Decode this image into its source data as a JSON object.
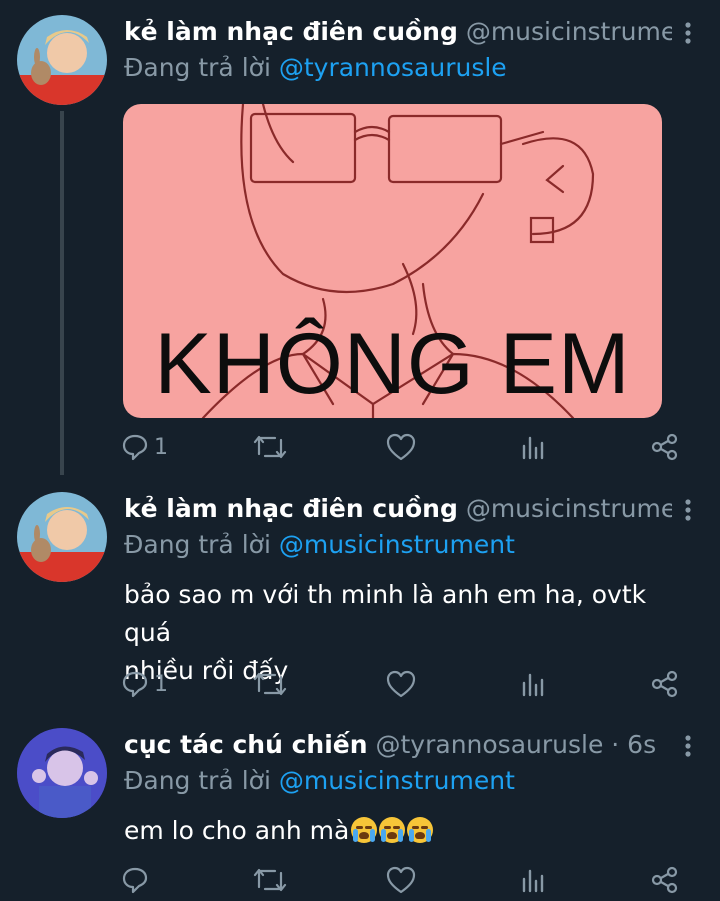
{
  "tweets": [
    {
      "name": "kẻ làm nhạc điên cuồng",
      "handle": "@musicinstrument ...",
      "replying_label": "Đang trả lời",
      "replying_to": "@tyrannosaurusle",
      "media_text": "KHÔNG EM",
      "replies": "1",
      "retweets": "",
      "likes": ""
    },
    {
      "name": "kẻ làm nhạc điên cuồng",
      "handle": "@musicinstrument ...",
      "replying_label": "Đang trả lời",
      "replying_to": "@musicinstrument",
      "text_line1": "bảo sao m với th minh là anh em ha, ovtk quá",
      "text_line2": "nhiều rồi đấy",
      "replies": "1",
      "retweets": "",
      "likes": ""
    },
    {
      "name": "cục tác chú chiến",
      "handle": "@tyrannosaurusle · 6s",
      "replying_label": "Đang trả lời",
      "replying_to": "@musicinstrument",
      "text": "em lo cho anh mà",
      "emojis": [
        "loudly-crying-face",
        "loudly-crying-face",
        "loudly-crying-face"
      ],
      "replies": "",
      "retweets": "",
      "likes": ""
    }
  ],
  "icons": {
    "reply": "reply-icon",
    "retweet": "retweet-icon",
    "like": "heart-icon",
    "analytics": "analytics-icon",
    "share": "share-icon",
    "more": "more-vertical-icon"
  },
  "colors": {
    "background": "#15202b",
    "secondary_text": "#8899a6",
    "link": "#1da1f2",
    "meme_background": "#f7a3a0"
  }
}
